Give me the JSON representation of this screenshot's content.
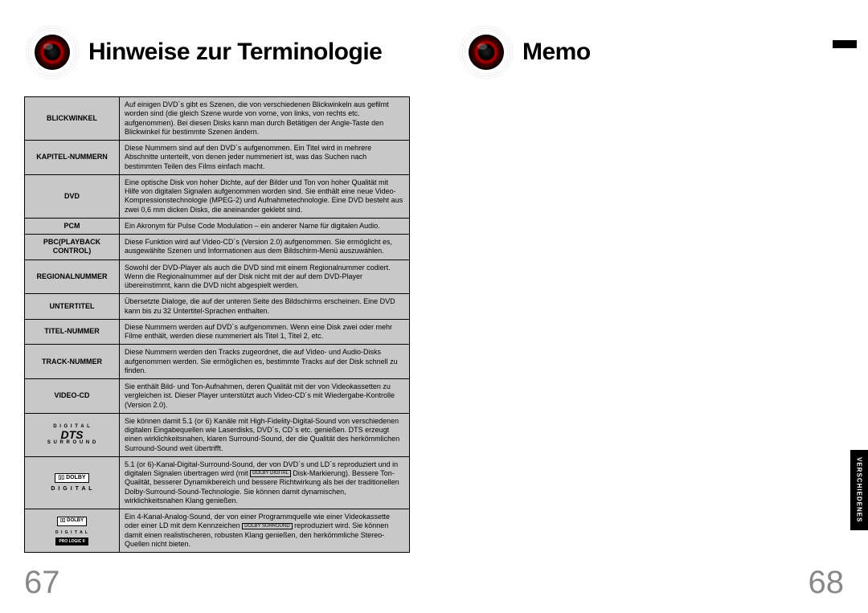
{
  "left": {
    "title": "Hinweise zur Terminologie",
    "page_num": "67",
    "rows": [
      {
        "term": "BLICKWINKEL",
        "desc": "Auf einigen DVD´s gibt es Szenen, die von verschiedenen Blickwinkeln aus gefilmt worden sind (die gleich Szene wurde von vorne, von links, von rechts etc. aufgenommen). Bei diesen Disks kann man durch Betätigen der Angle-Taste den Blickwinkel für bestimmte Szenen ändern."
      },
      {
        "term": "KAPITEL-NUMMERN",
        "desc": "Diese Nummern sind auf den DVD´s aufgenommen. Ein Titel wird in mehrere Abschnitte unterteilt, von denen jeder nummeriert ist, was das Suchen nach bestimmten Teilen des Films einfach macht."
      },
      {
        "term": "DVD",
        "desc": "Eine optische Disk von hoher Dichte, auf der Bilder und Ton von hoher Qualität mit Hilfe von digitalen Signalen aufgenommen worden sind. Sie enthält eine neue Video-Kompressionstechnologie (MPEG-2) und Aufnahmetechnologie. Eine DVD besteht aus zwei 0,6 mm dicken Disks, die aneinander geklebt sind."
      },
      {
        "term": "PCM",
        "desc": "Ein Akronym für Pulse Code Modulation – ein anderer Name für digitalen Audio."
      },
      {
        "term": "PBC(PLAYBACK CONTROL)",
        "desc": "Diese Funktion wird auf Video-CD´s (Version 2.0) aufgenommen. Sie ermöglicht es, ausgewählte Szenen und Informationen aus dem Bildschirm-Menü auszuwählen."
      },
      {
        "term": "REGIONALNUMMER",
        "desc": "Sowohl der DVD-Player als auch die DVD sind mit einem Regionalnummer codiert. Wenn die Regionalnummer auf der Disk nicht mit der auf dem DVD-Player übereinstimmt, kann die DVD nicht abgespielt werden."
      },
      {
        "term": "UNTERTITEL",
        "desc": "Übersetzte Dialoge, die auf der unteren Seite des Bildschirms erscheinen. Eine DVD kann bis zu 32 Untertitel-Sprachen enthalten."
      },
      {
        "term": "TITEL-NUMMER",
        "desc": "Diese Nummern werden auf DVD´s aufgenommen. Wenn eine Disk zwei oder mehr Filme enthält, werden diese nummeriert als Titel 1, Titel 2, etc."
      },
      {
        "term": "TRACK-NUMMER",
        "desc": "Diese Nummern werden den Tracks zugeordnet, die auf Video- und Audio-Disks aufgenommen werden. Sie ermöglichen es, bestimmte Tracks auf der Disk schnell zu finden."
      },
      {
        "term": "VIDEO-CD",
        "desc": "Sie enthält Bild- und Ton-Aufnahmen, deren Qualität mit der von Videokassetten zu vergleichen ist.\n Dieser Player unterstützt auch Video-CD´s mit Wiedergabe-Kontrolle (Version 2.0)."
      }
    ],
    "logo_rows": [
      {
        "logo_id": "dts",
        "desc": "Sie können damit 5.1 (or 6) Kanäle mit High-Fidelity-Digital-Sound von verschiedenen digitalen Eingabequellen wie Laserdisks, DVD´s, CD´s etc. genießen. DTS erzeugt einen wirklichkeitsnahen, klaren Surround-Sound, der die Qualität des herkömmlichen Surround-Sound weit übertrifft."
      },
      {
        "logo_id": "dolby_digital",
        "desc_pre": "5.1 (or 6)-Kanal-Digital-Surround-Sound, der von DVD´s und LD´s reproduziert und in digitalen Signalen übertragen wird (mit ",
        "desc_post": " Disk-Markierung). Bessere Ton-Qualität, besserer Dynamikbereich und bessere Richtwirkung als bei der traditionellen Dolby-Surround-Sound-Technologie. Sie können damit dynamischen, wirklichkeitsnahen Klang genießen."
      },
      {
        "logo_id": "dolby_prologic",
        "desc_pre": "Ein 4-Kanal-Analog-Sound, der von einer Programmquelle wie einer Videokassette oder einer LD mit dem Kennzeichen ",
        "desc_post": " reproduziert wird. Sie können damit einen realistischeren, robusten Klang genießen, den herkömmliche Stereo-Quellen nicht bieten."
      }
    ]
  },
  "right": {
    "title": "Memo",
    "page_num": "68",
    "side_tab": "VERSCHIEDENES"
  },
  "logos": {
    "dts": {
      "top": "D I G I T A L",
      "mid": "dts",
      "bot": "S U R R O U N D"
    },
    "dolby_digital": {
      "line1": "DOLBY",
      "line2": "D I G I T A L"
    },
    "dolby_prologic": {
      "line1": "DOLBY",
      "line2": "D I G I T A L",
      "line3": "PRO LOGIC II"
    },
    "inline_dd": "DOLBY DIGITAL",
    "inline_ds": "DOLBY SURROUND"
  }
}
